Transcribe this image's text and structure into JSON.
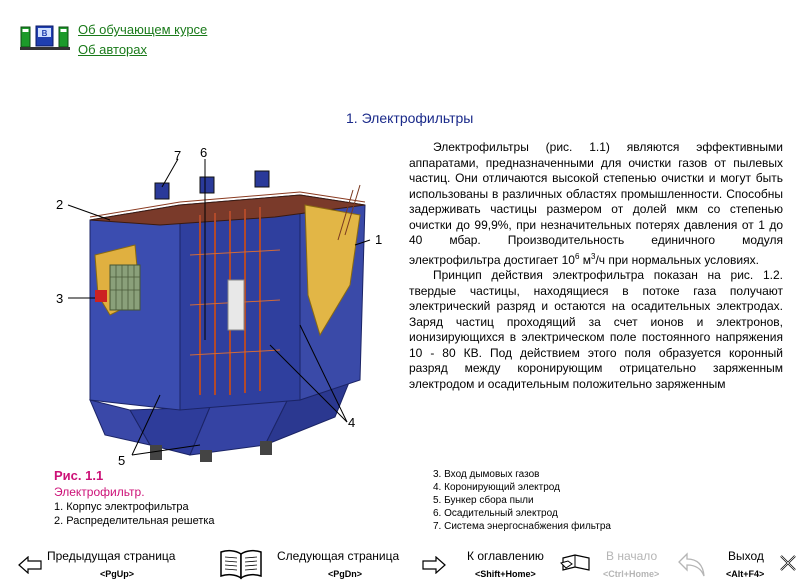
{
  "links": {
    "about_course": "Об обучающем курсе",
    "about_authors": "Об авторах"
  },
  "title": "1. Электрофильтры",
  "figure": {
    "labels": [
      "1",
      "2",
      "3",
      "4",
      "5",
      "6",
      "7"
    ],
    "caption_title": "Рис. 1.1",
    "caption_subtitle": "Электрофильтр.",
    "legend_left": [
      "1. Корпус электрофильтра",
      "2. Распределительная решетка"
    ],
    "legend_right": [
      "3. Вход дымовых газов",
      "4. Коронирующий электрод",
      "5. Бункер сбора пыли",
      "6. Осадительный электрод",
      "7. Система энергоснабжения фильтра"
    ]
  },
  "text": {
    "p1_before": "Электрофильтры (рис. 1.1) являются эффективными аппаратами, предназначенными для очистки газов от пылевых частиц. Они отличаются высокой степенью очистки и могут быть использованы в различных областях промышленности. Способны задерживать частицы размером от долей мкм со степенью очистки до 99,9%, при незначительных потерях давления от 1 до 40 мбар. Производительность единичного модуля электрофильтра достигает 10",
    "p1_sup1": "6",
    "p1_mid": " м",
    "p1_sup2": "3",
    "p1_after": "/ч при нормальных условиях.",
    "p2": "Принцип действия электрофильтра показан на рис. 1.2. твердые частицы, находящиеся в потоке газа получают электрический разряд и остаются на осадительных электродах. Заряд частиц проходящий за счет ионов и электронов, ионизирующихся в электрическом поле постоянного напряжения 10 - 80 КВ. Под действием этого поля образуется коронный разряд между коронирующим отрицательно заряженным электродом и осадительным положительно заряженным"
  },
  "nav": {
    "prev_label": "Предыдущая страница",
    "prev_key": "<PgUp>",
    "next_label": "Следующая страница",
    "next_key": "<PgDn>",
    "toc_label": "К оглавлению",
    "toc_key": "<Shift+Home>",
    "home_label": "В начало",
    "home_key": "<Ctrl+Home>",
    "exit_label": "Выход",
    "exit_key": "<Alt+F4>"
  },
  "colors": {
    "link": "#1a7a1a",
    "title": "#1a2a8a",
    "caption": "#cc1177",
    "disabled": "#b5b5b5"
  }
}
